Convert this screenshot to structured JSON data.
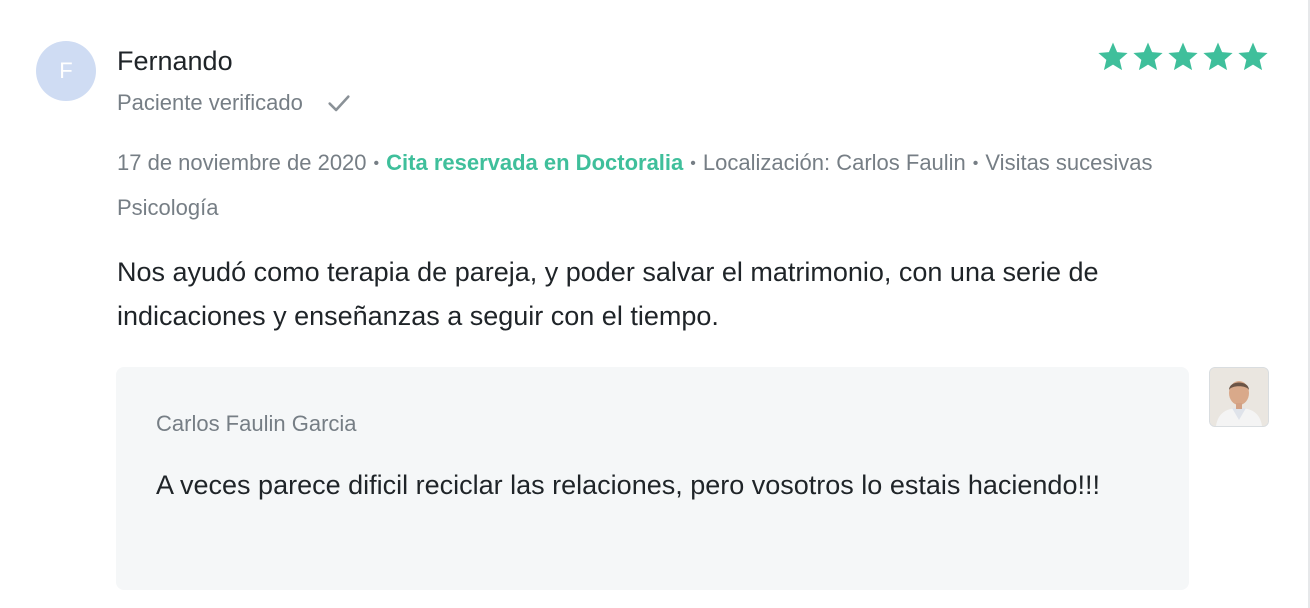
{
  "review": {
    "avatar_initial": "F",
    "reviewer_name": "Fernando",
    "verified_label": "Paciente verificado",
    "rating": 5,
    "rating_max": 5,
    "star_color": "#3fbf9b",
    "date": "17 de noviembre de 2020",
    "separator": "•",
    "booking_label": "Cita reservada en Doctoralia",
    "location": "Localización: Carlos Faulin",
    "visit_type": "Visitas sucesivas",
    "specialty": "Psicología",
    "text": "Nos ayudó como terapia de pareja, y poder salvar el matrimonio, con una serie de indicaciones y enseñanzas a seguir con el tiempo."
  },
  "reply": {
    "author": "Carlos Faulin Garcia",
    "text": "A veces parece dificil reciclar las relaciones, pero vosotros lo estais haciendo!!!"
  },
  "icons": {
    "check": "check-icon",
    "star": "star-icon",
    "doctor_photo": "doctor-photo"
  }
}
